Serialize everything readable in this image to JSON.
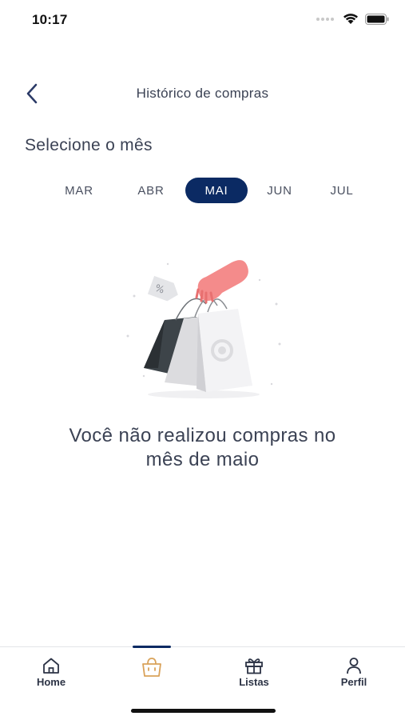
{
  "status_bar": {
    "time": "10:17"
  },
  "header": {
    "title": "Histórico de compras"
  },
  "select_label": "Selecione o mês",
  "months": [
    {
      "label": "MAR",
      "active": false
    },
    {
      "label": "ABR",
      "active": false
    },
    {
      "label": "MAI",
      "active": true
    },
    {
      "label": "JUN",
      "active": false
    },
    {
      "label": "JUL",
      "active": false
    }
  ],
  "empty_state": {
    "line1": "Você não realizou compras no",
    "line2": "mês de maio"
  },
  "bottom_nav": {
    "items": [
      {
        "label": "Home",
        "icon": "home-icon"
      },
      {
        "label": "",
        "icon": "shopping-bag-icon",
        "active": true
      },
      {
        "label": "Listas",
        "icon": "gift-icon"
      },
      {
        "label": "Perfil",
        "icon": "user-icon"
      }
    ]
  },
  "colors": {
    "accent": "#0b2a63",
    "bag_icon": "#d9a25a",
    "text": "#3b4254",
    "hand": "#f48b8b"
  }
}
